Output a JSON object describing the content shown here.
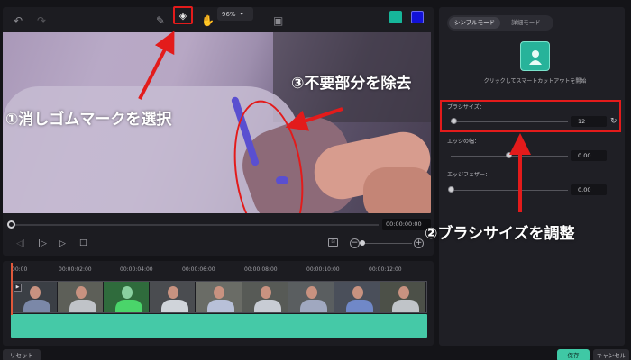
{
  "toolbar": {
    "undo_icon": "undo-icon",
    "redo_icon": "redo-icon",
    "brush_icon": "brush-icon",
    "eraser_icon": "eraser-icon",
    "hand_icon": "hand-icon",
    "zoom_value": "96%",
    "highlight_color": "#e31b1b"
  },
  "player": {
    "time": "00:00:00:00"
  },
  "timeline": {
    "ruler_labels": [
      "00:00",
      "00:00:02:00",
      "00:00:04:00",
      "00:00:06:00",
      "00:00:08:00",
      "00:00:10:00",
      "00:00:12:00"
    ],
    "clip_count": 9,
    "audio_color": "#45c9a7"
  },
  "panel": {
    "tabs": [
      "シンプルモード",
      "詳細モード"
    ],
    "active_tab": 0,
    "cutout_caption": "クリックしてスマートカットアウトを開始",
    "settings": [
      {
        "label": "ブラシサイズ：",
        "value": "12"
      },
      {
        "label": "エッジの幅：",
        "value": "0.00"
      },
      {
        "label": "エッジフェザー：",
        "value": "0.00"
      }
    ]
  },
  "buttons": {
    "reset": "リセット",
    "save": "保存",
    "cancel": "キャンセル"
  },
  "annotations": {
    "step1": "①消しゴムマークを選択",
    "step2": "②ブラシサイズを調整",
    "step3": "③不要部分を除去"
  }
}
